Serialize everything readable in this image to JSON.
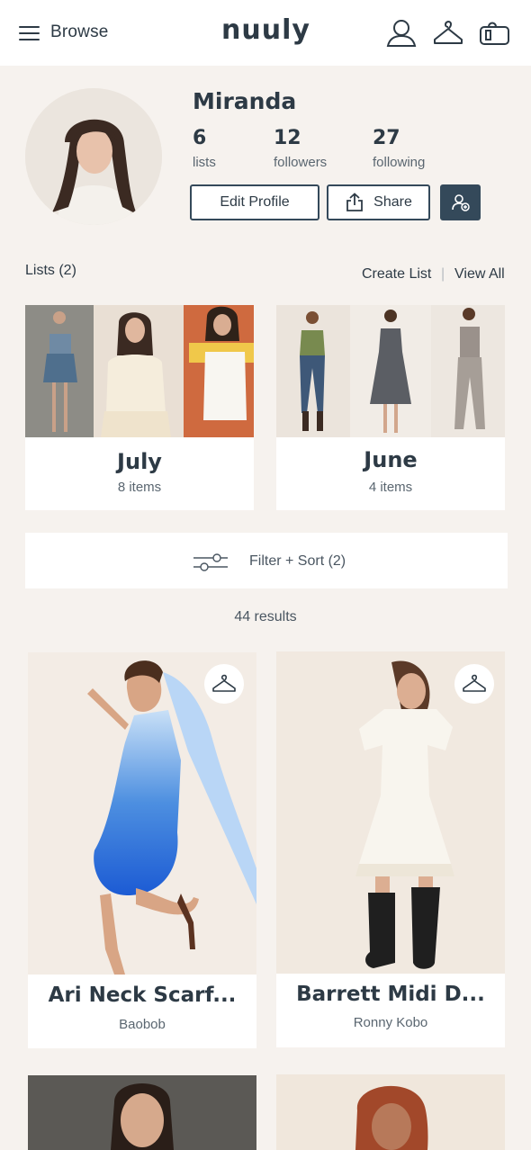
{
  "header": {
    "browse_label": "Browse",
    "logo_text": "nuuly",
    "icons": [
      "menu-icon",
      "account-icon",
      "hanger-icon",
      "box-icon"
    ]
  },
  "profile": {
    "name": "Miranda",
    "stats": [
      {
        "value": "6",
        "label": "lists"
      },
      {
        "value": "12",
        "label": "followers"
      },
      {
        "value": "27",
        "label": "following"
      }
    ],
    "edit_label": "Edit Profile",
    "share_label": "Share"
  },
  "lists": {
    "title": "Lists (2)",
    "create_label": "Create List",
    "separator": "|",
    "view_all_label": "View All",
    "items": [
      {
        "title": "July",
        "count": "8 items"
      },
      {
        "title": "June",
        "count": "4 items"
      }
    ]
  },
  "filter": {
    "label": "Filter + Sort (2)",
    "results": "44 results"
  },
  "products": [
    {
      "name": "Ari Neck Scarf...",
      "brand": "Baobob"
    },
    {
      "name": "Barrett Midi D...",
      "brand": "Ronny Kobo"
    }
  ],
  "colors": {
    "accent": "#34495a",
    "page_bg": "#f6f2ee"
  }
}
